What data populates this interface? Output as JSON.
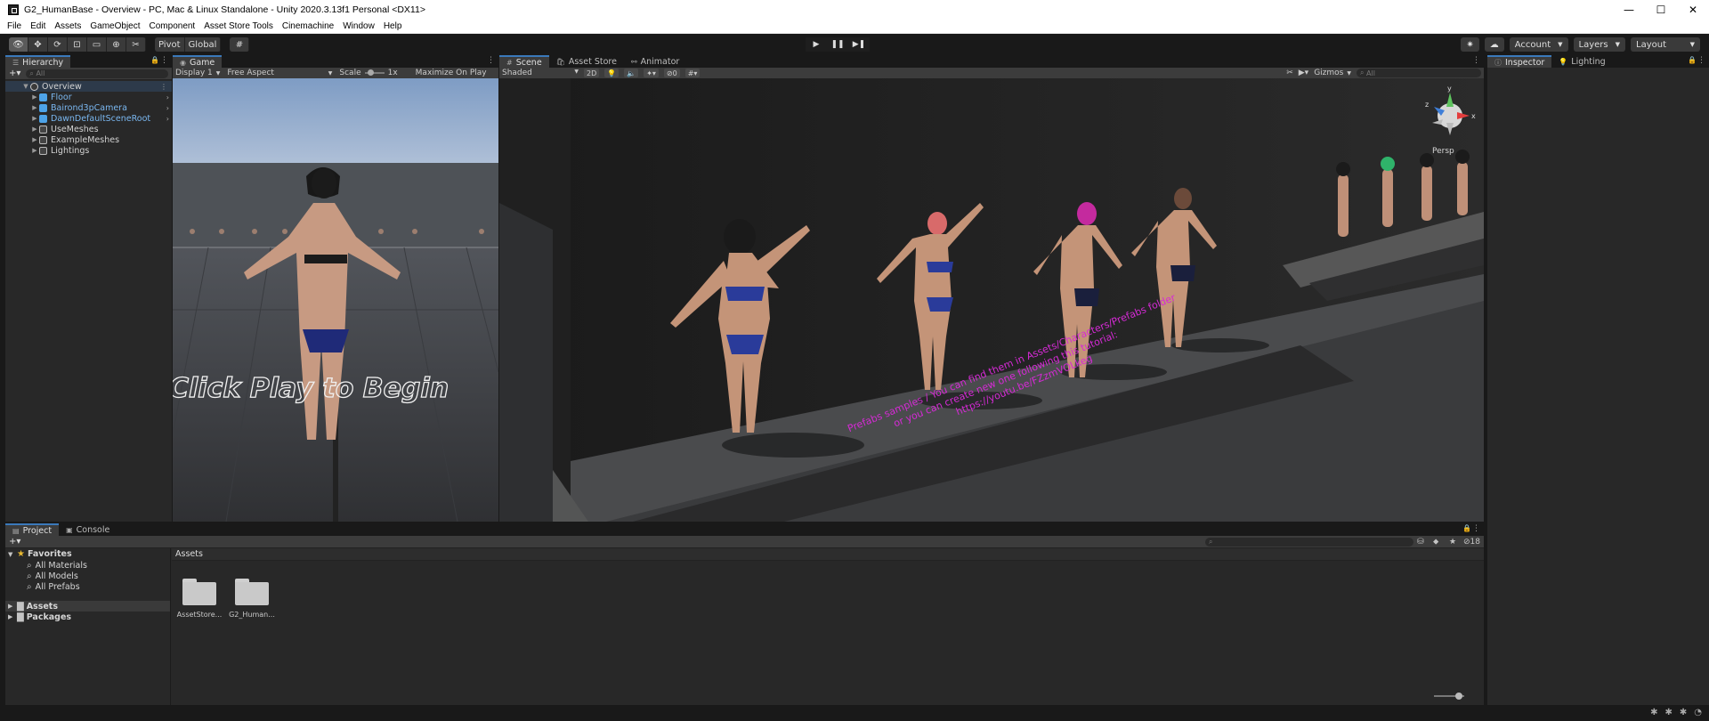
{
  "window": {
    "title": "G2_HumanBase - Overview - PC, Mac & Linux Standalone - Unity 2020.3.13f1 Personal <DX11>",
    "minimize": "—",
    "maximize": "☐",
    "close": "✕"
  },
  "menu": [
    "File",
    "Edit",
    "Assets",
    "GameObject",
    "Component",
    "Asset Store Tools",
    "Cinemachine",
    "Window",
    "Help"
  ],
  "toolbar": {
    "pivot": "Pivot",
    "global": "Global",
    "play": "▶",
    "pause": "❚❚",
    "step": "▶❚",
    "account": "Account",
    "layers": "Layers",
    "layout": "Layout"
  },
  "hierarchy": {
    "tab": "Hierarchy",
    "search_placeholder": "All",
    "scene": "Overview",
    "items": [
      {
        "label": "Floor",
        "type": "prefab"
      },
      {
        "label": "Bairond3pCamera",
        "type": "prefab"
      },
      {
        "label": "DawnDefaultSceneRoot",
        "type": "prefab"
      },
      {
        "label": "UseMeshes",
        "type": "object"
      },
      {
        "label": "ExampleMeshes",
        "type": "object"
      },
      {
        "label": "Lightings",
        "type": "object"
      }
    ]
  },
  "game": {
    "tab": "Game",
    "display": "Display 1",
    "aspect": "Free Aspect",
    "scale_label": "Scale",
    "scale_value": "1x",
    "maximize": "Maximize On Play",
    "overlay_text": "Click Play to Begin"
  },
  "scene": {
    "tabs": [
      "Scene",
      "Asset Store",
      "Animator"
    ],
    "shading": "Shaded",
    "mode_2d": "2D",
    "hidden_count": "0",
    "gizmos": "Gizmos",
    "search_placeholder": "All",
    "persp": "Persp",
    "axis_x": "x",
    "axis_y": "y",
    "axis_z": "z",
    "floor_text_1": "Prefabs samples / You can find them in Assets/Characters/Prefabs folder",
    "floor_text_2": "or you can create new one following this tutorial:",
    "floor_text_3": "https://youtu.be/FZzmVOLkeg"
  },
  "inspector": {
    "tabs": [
      "Inspector",
      "Lighting"
    ]
  },
  "project": {
    "tabs": [
      "Project",
      "Console"
    ],
    "favorites_label": "Favorites",
    "favorites": [
      "All Materials",
      "All Models",
      "All Prefabs"
    ],
    "roots": [
      "Assets",
      "Packages"
    ],
    "assets_header": "Assets",
    "folders": [
      "AssetStore...",
      "G2_Human..."
    ],
    "hidden_count": "18"
  },
  "colors": {
    "accent": "#3a79bb",
    "floor_text": "#d62ad6",
    "prefab_text": "#7ab7f0",
    "panel_bg": "#282828"
  }
}
